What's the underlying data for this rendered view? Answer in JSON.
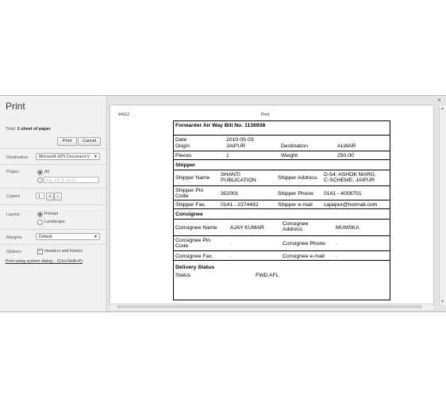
{
  "sidebar": {
    "title": "Print",
    "total_label": "Total:",
    "total_value": "1 sheet of paper",
    "print_button": "Print",
    "cancel_button": "Cancel",
    "destination_label": "Destination",
    "destination_value": "Microsoft XPS Document V",
    "pages_label": "Pages",
    "pages_all": "All",
    "pages_placeholder": "e.g. 1-5, 8, 11-13",
    "copies_label": "Copies",
    "copies_value": "1",
    "layout_label": "Layout",
    "layout_portrait": "Portrait",
    "layout_landscape": "Landscape",
    "margins_label": "Margins",
    "margins_value": "Default",
    "options_label": "Options",
    "options_headers": "Headers and footers",
    "system_dialog_link": "Print using system dialog... (Ctrl+Shift+P)"
  },
  "preview": {
    "header_date": "4/4/12",
    "header_title": "Print"
  },
  "bill": {
    "title": "Forwarder Air Way Bill No. 1136938",
    "date_label": "Date",
    "date_value": "2010-05-03",
    "origin_label": "Origin",
    "origin_value": "JAIPUR",
    "destination_label": "Destination",
    "destination_value": "ALWAR",
    "pieces_label": "Pieces",
    "pieces_value": "1",
    "weight_label": "Weight",
    "weight_value": "250.00",
    "shipper_heading": "Shipper",
    "shipper_name_label": "Shipper Name",
    "shipper_name_line1": "SHANTI",
    "shipper_name_line2": "PUBLICATION",
    "shipper_address_label": "Shipper Address",
    "shipper_address_line1": "D-54, ASHOK MARG,",
    "shipper_address_line2": "C-SCHEME, JAIPUR",
    "shipper_pin_label_1": "Shipper Pin",
    "shipper_pin_label_2": "Code",
    "shipper_pin_value": "302001",
    "shipper_phone_label": "Shipper Phone",
    "shipper_phone_value": "0141 - 4006701",
    "shipper_fax_label": "Shipper Fax.",
    "shipper_fax_value": "0141 - 2374492",
    "shipper_email_label": "Shipper e-mail",
    "shipper_email_value": "cajaipur@hotmail.com",
    "consignee_heading": "Consignee",
    "consignee_name_label": "Consignee Name",
    "consignee_name_value": "AJAY KUMAR",
    "consignee_address_label_1": "Consignee",
    "consignee_address_label_2": "Address",
    "consignee_address_value": "MUMSKA",
    "consignee_pin_label_1": "Consignee Pin",
    "consignee_pin_label_2": "Code",
    "consignee_pin_value": ".",
    "consignee_phone_label": "Consignee Phone",
    "consignee_phone_value": ".",
    "consignee_fax_label": "Consignee Fax.",
    "consignee_fax_value": ".",
    "consignee_email_label": "Consignee e-mail",
    "consignee_email_value": ".",
    "delivery_heading": "Delivery Status",
    "status_label": "Status",
    "status_value": "FWD  AFL"
  }
}
